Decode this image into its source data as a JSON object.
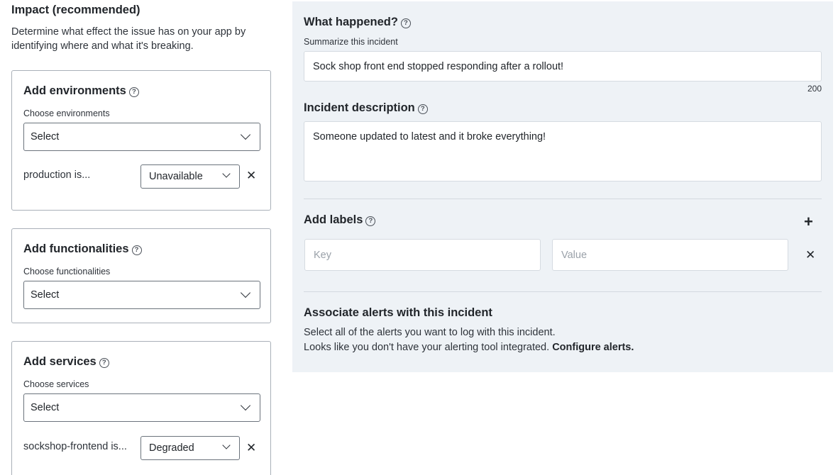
{
  "impact": {
    "title": "Impact (recommended)",
    "description": "Determine what effect the issue has on your app by identifying where and what it's breaking."
  },
  "environments": {
    "title": "Add environments",
    "sublabel": "Choose environments",
    "select_value": "Select",
    "rows": [
      {
        "label": "production is...",
        "status": "Unavailable"
      }
    ]
  },
  "functionalities": {
    "title": "Add functionalities",
    "sublabel": "Choose functionalities",
    "select_value": "Select"
  },
  "services": {
    "title": "Add services",
    "sublabel": "Choose services",
    "select_value": "Select",
    "rows": [
      {
        "label": "sockshop-frontend is...",
        "status": "Degraded"
      }
    ]
  },
  "what_happened": {
    "title": "What happened?",
    "sublabel": "Summarize this incident",
    "value": "Sock shop front end stopped responding after a rollout!",
    "counter": "200"
  },
  "description": {
    "title": "Incident description",
    "value": "Someone updated to latest and it broke everything!"
  },
  "labels": {
    "title": "Add labels",
    "key_placeholder": "Key",
    "value_placeholder": "Value"
  },
  "alerts": {
    "title": "Associate alerts with this incident",
    "line1": "Select all of the alerts you want to log with this incident.",
    "line2": "Looks like you don't have your alerting tool integrated.",
    "link": "Configure alerts."
  },
  "icons": {
    "help": "?",
    "close": "✕",
    "add": "+"
  }
}
